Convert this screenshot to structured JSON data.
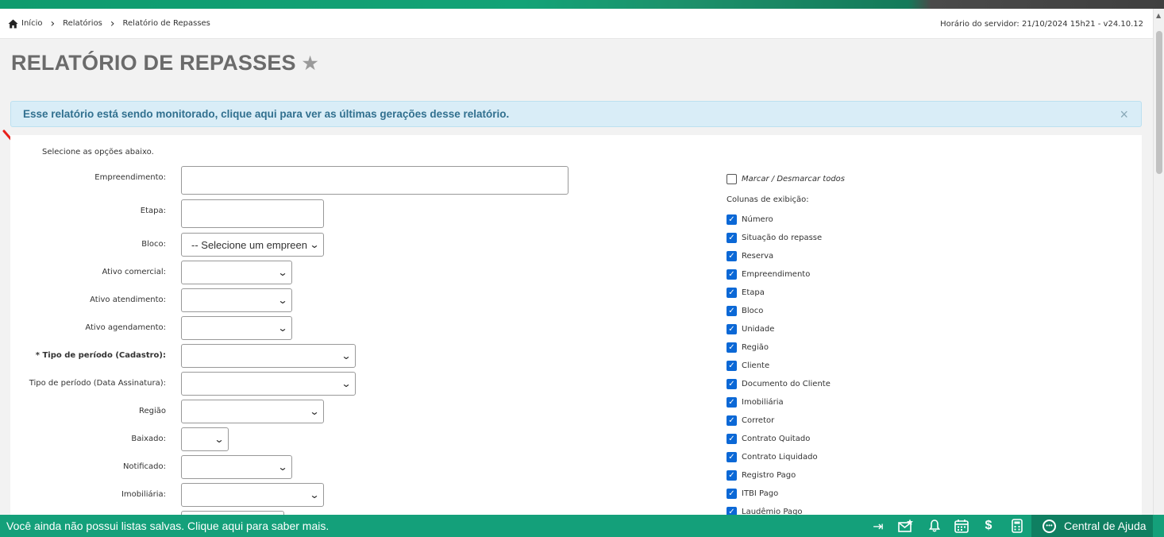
{
  "breadcrumb": {
    "home": "Início",
    "items": [
      "Relatórios",
      "Relatório de Repasses"
    ]
  },
  "server_time": "Horário do servidor: 21/10/2024 15h21 - v24.10.12",
  "page_title": "RELATÓRIO DE REPASSES",
  "alert": {
    "text": "Esse relatório está sendo monitorado, clique aqui para ver as últimas gerações desse relatório.",
    "close": "×"
  },
  "form": {
    "instructions": "Selecione as opções abaixo.",
    "fields": [
      {
        "label": "Empreendimento:",
        "value": ""
      },
      {
        "label": "Etapa:",
        "value": ""
      },
      {
        "label": "Bloco:",
        "value": "-- Selecione um empreendimento"
      },
      {
        "label": "Ativo comercial:",
        "value": ""
      },
      {
        "label": "Ativo atendimento:",
        "value": ""
      },
      {
        "label": "Ativo agendamento:",
        "value": ""
      },
      {
        "label": "* Tipo de período (Cadastro):",
        "value": ""
      },
      {
        "label": "Tipo de período (Data Assinatura):",
        "value": ""
      },
      {
        "label": "Região",
        "value": ""
      },
      {
        "label": "Baixado:",
        "value": ""
      },
      {
        "label": "Notificado:",
        "value": ""
      },
      {
        "label": "Imobiliária:",
        "value": ""
      },
      {
        "label": "",
        "value": ""
      }
    ]
  },
  "columns": {
    "toggle_all": "Marcar / Desmarcar todos",
    "title": "Colunas de exibição:",
    "items": [
      "Número",
      "Situação do repasse",
      "Reserva",
      "Empreendimento",
      "Etapa",
      "Bloco",
      "Unidade",
      "Região",
      "Cliente",
      "Documento do Cliente",
      "Imobiliária",
      "Corretor",
      "Contrato Quitado",
      "Contrato Liquidado",
      "Registro Pago",
      "ITBI Pago",
      "Laudêmio Pago"
    ]
  },
  "bottom_bar": {
    "saved_lists": "Você ainda não possui listas salvas. Clique aqui para saber mais.",
    "help": "Central de Ajuda",
    "icons": [
      "export-icon",
      "mail-star-icon",
      "bell-icon",
      "calendar-icon",
      "dollar-icon",
      "calculator-icon"
    ]
  },
  "colors": {
    "accent": "#14a07a",
    "alert_bg": "#d9edf7",
    "checkbox": "#0b68d6"
  }
}
